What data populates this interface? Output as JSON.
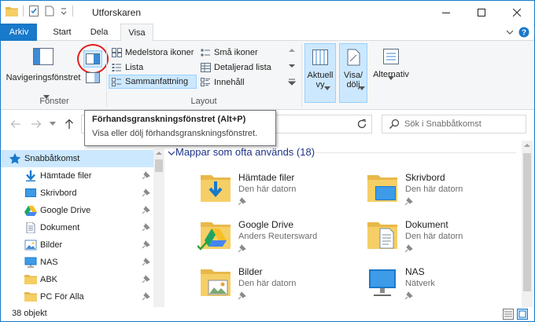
{
  "window": {
    "title": "Utforskaren"
  },
  "tabs": [
    {
      "label": "Arkiv"
    },
    {
      "label": "Start"
    },
    {
      "label": "Dela"
    },
    {
      "label": "Visa"
    }
  ],
  "ribbon": {
    "panes": {
      "nav_pane_label": "Navigeringsfönstret",
      "group_label": "Fönster"
    },
    "layout": {
      "items": [
        {
          "label": "Medelstora ikoner"
        },
        {
          "label": "Små ikoner"
        },
        {
          "label": "Lista"
        },
        {
          "label": "Detaljerad lista"
        },
        {
          "label": "Sammanfattning"
        },
        {
          "label": "Innehåll"
        }
      ],
      "group_label": "Layout"
    },
    "view": {
      "current_view_label_1": "Aktuell",
      "current_view_label_2": "vy",
      "showhide_label_1": "Visa/",
      "showhide_label_2": "dölj",
      "options_label": "Alternativ"
    }
  },
  "tooltip": {
    "title": "Förhandsgranskningsfönstret (Alt+P)",
    "description": "Visa eller dölj förhandsgranskningsfönstret."
  },
  "search": {
    "placeholder": "Sök i Snabbåtkomst"
  },
  "sidebar": {
    "items": [
      {
        "label": "Snabbåtkomst"
      },
      {
        "label": "Hämtade filer"
      },
      {
        "label": "Skrivbord"
      },
      {
        "label": "Google Drive"
      },
      {
        "label": "Dokument"
      },
      {
        "label": "Bilder"
      },
      {
        "label": "NAS"
      },
      {
        "label": "ABK"
      },
      {
        "label": "PC För Alla"
      }
    ]
  },
  "content": {
    "section_title": "Mappar som ofta används (18)",
    "folders": [
      {
        "name": "Hämtade filer",
        "sub": "Den här datorn"
      },
      {
        "name": "Skrivbord",
        "sub": "Den här datorn"
      },
      {
        "name": "Google Drive",
        "sub": "Anders Reutersward"
      },
      {
        "name": "Dokument",
        "sub": "Den här datorn"
      },
      {
        "name": "Bilder",
        "sub": "Den här datorn"
      },
      {
        "name": "NAS",
        "sub": "Nätverk"
      }
    ]
  },
  "status": {
    "count": "38 objekt"
  },
  "colors": {
    "accent": "#1979ca",
    "selection": "#cce8ff",
    "folder": "#f5cf66",
    "highlight_circle": "#e21d1d"
  }
}
